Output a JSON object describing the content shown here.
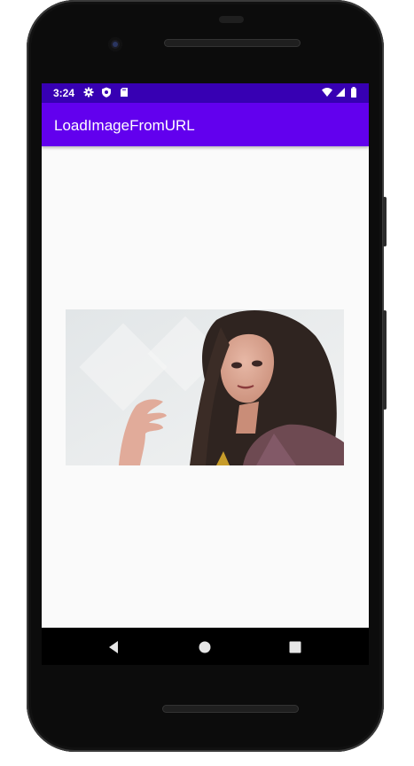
{
  "status_bar": {
    "time": "3:24",
    "left_icons": [
      "gear-icon",
      "shield-icon",
      "sd-card-icon"
    ],
    "right_icons": [
      "wifi-icon",
      "signal-icon",
      "battery-icon"
    ]
  },
  "app_bar": {
    "title": "LoadImageFromURL"
  },
  "nav_bar": {
    "buttons": [
      "back-icon",
      "home-icon",
      "recents-icon"
    ]
  },
  "colors": {
    "status_bar": "#3700b3",
    "app_bar": "#6200ee",
    "screen_background": "#fafafa"
  }
}
